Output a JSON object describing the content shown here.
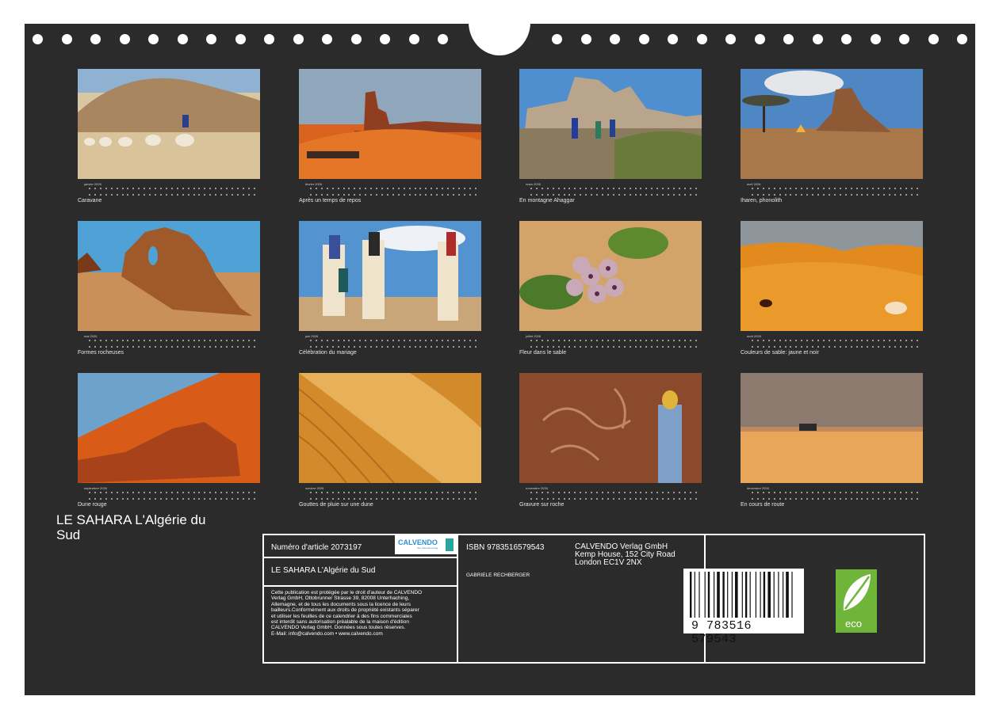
{
  "months": [
    {
      "month": "janvier 2026",
      "caption": "Caravane"
    },
    {
      "month": "février 2026",
      "caption": "Après un temps de repos"
    },
    {
      "month": "mars 2026",
      "caption": "En montagne Ahaggar"
    },
    {
      "month": "avril 2026",
      "caption": "Iharen, phonolith"
    },
    {
      "month": "mai 2026",
      "caption": "Formes rocheuses"
    },
    {
      "month": "juin 2026",
      "caption": "Célébration du mariage"
    },
    {
      "month": "juillet 2026",
      "caption": "Fleur dans le sable"
    },
    {
      "month": "août 2026",
      "caption": "Couleurs de sable: jaune et noir"
    },
    {
      "month": "septembre 2026",
      "caption": "Dune rouge"
    },
    {
      "month": "octobre 2026",
      "caption": "Gouttes de pluie sur une dune"
    },
    {
      "month": "novembre 2026",
      "caption": "Gravure sur roche"
    },
    {
      "month": "décembre 2026",
      "caption": "En cours de route"
    }
  ],
  "cover_title": "LE SAHARA  L'Algérie du Sud",
  "back": {
    "article": "Numéro d'article 2073197",
    "title": "LE SAHARA  L'Algérie du Sud",
    "isbn": "ISBN 9783516579543",
    "author": "GABRIELE RECHBERGER",
    "publisher_lines": [
      "CALVENDO Verlag GmbH",
      "Kemp House, 152 City Road",
      "London EC1V 2NX"
    ],
    "legal_lines": [
      "Cette publication est protégée par le droit d'auteur de CALVENDO",
      "Verlag GmbH, Ottobrunner Strasse 39, 82008 Unterhaching,",
      "Allemagne, et de tous les documents sous la licence de leurs",
      "bailleurs.Conformément aux droits de propriété existants séparer",
      "et utiliser les feuilles de ce calendrier à des fins commerciales",
      "est interdit sans autorisation préalable de la maison d'édition",
      "CALVENDO Verlag GmbH. Données sous toutes réserves.",
      "E-Mail: info@calvendo.com • www.calvendo.com"
    ],
    "logo_text": "CALVENDO",
    "logo_sub": "Ihre Kalenderverlag",
    "barcode_number": "9 783516 579543",
    "eco_label": "eco"
  }
}
